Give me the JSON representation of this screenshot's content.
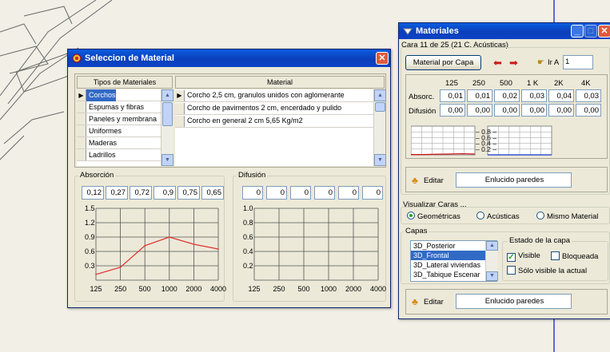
{
  "sel_dialog": {
    "title": "Seleccion de Material",
    "types_header": "Tipos de Materiales",
    "types": [
      "Corchos",
      "Espumas y fibras",
      "Paneles y membrana",
      "Uniformes",
      "Maderas",
      "Ladrillos"
    ],
    "material_header": "Material",
    "materials": [
      "Corcho 2,5 cm, granulos unidos con aglomerante",
      "Corcho de pavimentos 2 cm, encerdado y pulido",
      "Corcho en general  2 cm 5,65 Kg/m2"
    ],
    "absorcion_label": "Absorción",
    "absorcion_values": [
      "0,12",
      "0,27",
      "0,72",
      "0,9",
      "0,75",
      "0,65"
    ],
    "difusion_label": "Difusión",
    "difusion_values": [
      "0",
      "0",
      "0",
      "0",
      "0",
      "0"
    ],
    "y_ticks": [
      "1.5",
      "1.2",
      "0.9",
      "0.6",
      "0.3"
    ],
    "y_ticks_dif": [
      "1.0",
      "0.8",
      "0.6",
      "0.4",
      "0.2"
    ],
    "x_ticks": [
      "125",
      "250",
      "500",
      "1000",
      "2000",
      "4000"
    ]
  },
  "chart_data": {
    "type": "line",
    "categories": [
      "125",
      "250",
      "500",
      "1000",
      "2000",
      "4000"
    ],
    "series": [
      {
        "values": [
          0.12,
          0.27,
          0.72,
          0.9,
          0.75,
          0.65
        ]
      }
    ],
    "ylim": [
      0,
      1.5
    ],
    "grid": true
  },
  "mat_window": {
    "title": "Materiales",
    "cara_label": "Cara 11 de 25 (21 C. Acústicas)",
    "material_por_capa": "Material por Capa",
    "ir_a_label": "Ir A",
    "ir_a_value": "1",
    "freqs": [
      "125",
      "250",
      "500",
      "1 K",
      "2K",
      "4K"
    ],
    "absorc_label": "Absorc.",
    "absorc_values": [
      "0,01",
      "0,01",
      "0,02",
      "0,03",
      "0,04",
      "0,03"
    ],
    "difusion_label": "Difusión",
    "difusion_values": [
      "0,00",
      "0,00",
      "0,00",
      "0,00",
      "0,00",
      "0,00"
    ],
    "mini_ticks": [
      "0.8",
      "0.6",
      "0.4",
      "0.2"
    ],
    "editar_label": "Editar",
    "material_name": "Enlucido paredes",
    "visualizar_label": "Visualizar Caras ...",
    "radio_geometricas": "Geométricas",
    "radio_acusticas": "Acústicas",
    "radio_mismo": "Mismo Material",
    "capas_label": "Capas",
    "capas": [
      "3D_Posterior",
      "3D_Frontal",
      "3D_Lateral viviendas",
      "3D_Tabique Escenar"
    ],
    "estado_label": "Estado de la capa",
    "visible_label": "Visible",
    "bloqueada_label": "Bloqueada",
    "solo_visible_label": "Sólo visible la actual",
    "editar2_label": "Editar",
    "material_name2": "Enlucido paredes"
  }
}
